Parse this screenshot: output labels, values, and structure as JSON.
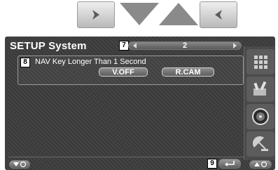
{
  "screen": {
    "title": "SETUP System",
    "page_number": "2",
    "setting": {
      "label": "NAV Key Longer Than 1 Second",
      "options": [
        "V.OFF",
        "R.CAM"
      ]
    }
  },
  "callouts": {
    "setting": "8",
    "pager": "7",
    "return": "9"
  },
  "sidebar": {
    "icons": [
      "grid-icon",
      "tools-icon",
      "speaker-icon",
      "satellite-icon"
    ]
  },
  "colors": {
    "screen_bg": "#3a3a3a",
    "button_face": "#6e6e6e",
    "text": "#ffffff",
    "triangle": "#8a8a8a"
  }
}
